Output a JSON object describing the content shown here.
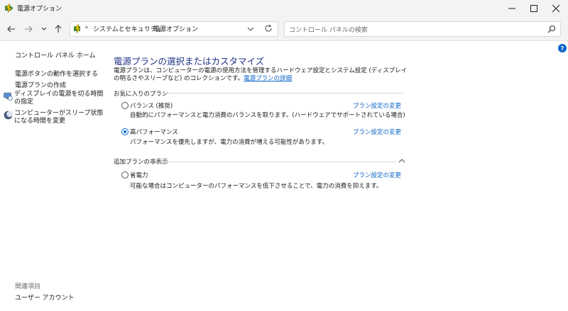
{
  "window": {
    "title": "電源オプション",
    "controls": {
      "minimize": "minimize-icon",
      "maximize": "maximize-icon",
      "close": "close-icon"
    }
  },
  "nav": {
    "back": "arrow-left-icon",
    "forward": "arrow-right-icon",
    "recent": "chevron-down-icon",
    "up": "arrow-up-icon"
  },
  "address": {
    "chevrons": "«",
    "crumbs": [
      "システムとセキュリティ",
      "電源オプション"
    ],
    "separator": "›"
  },
  "search": {
    "placeholder": "コントロール パネルの検索"
  },
  "sidebar": {
    "home": "コントロール パネル ホーム",
    "items": [
      "電源ボタンの動作を選択する",
      "電源プランの作成",
      "ディスプレイの電源を切る時間の指定",
      "コンピューターがスリープ状態になる時間を変更"
    ],
    "related_title": "関連項目",
    "related": [
      "ユーザー アカウント"
    ]
  },
  "main": {
    "title": "電源プランの選択またはカスタマイズ",
    "description": "電源プランは、コンピューターの電源の使用方法を管理するハードウェア設定とシステム設定 (ディスプレイの明るさやスリープなど) のコレクションです。",
    "description_link": "電源プランの詳細",
    "favorites": {
      "heading": "お気に入りのプラン",
      "plans": [
        {
          "name": "バランス (推奨)",
          "desc": "自動的にパフォーマンスと電力消費のバランスを取ります。(ハードウェアでサポートされている場合)",
          "link": "プラン設定の変更",
          "selected": false
        },
        {
          "name": "高パフォーマンス",
          "desc": "パフォーマンスを優先しますが、電力の消費が増える可能性があります。",
          "link": "プラン設定の変更",
          "selected": true
        }
      ]
    },
    "extra": {
      "heading": "追加プランの非表示",
      "plans": [
        {
          "name": "省電力",
          "desc": "可能な場合はコンピューターのパフォーマンスを低下させることで、電力の消費を抑えます。",
          "link": "プラン設定の変更",
          "selected": false
        }
      ]
    }
  },
  "help": {
    "label": "?"
  },
  "colors": {
    "accent": "#0a64c8",
    "title": "#1e3287",
    "chrome": "#f3f3f3"
  }
}
